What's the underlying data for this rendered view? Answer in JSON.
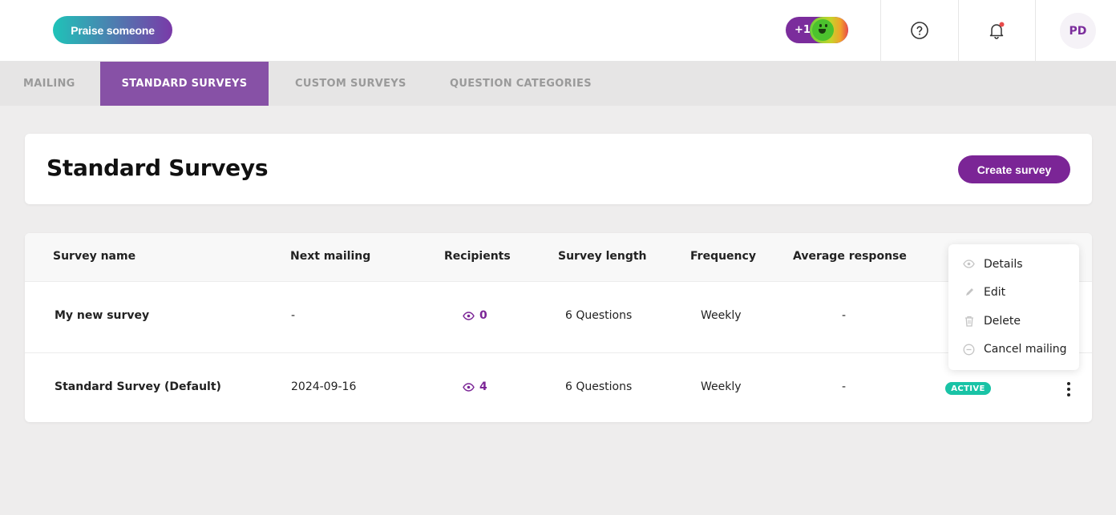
{
  "header": {
    "praise_label": "Praise someone",
    "karma_label": "+1",
    "avatar_initials": "PD"
  },
  "tabs": [
    {
      "label": "MAILING",
      "active": false
    },
    {
      "label": "STANDARD SURVEYS",
      "active": true
    },
    {
      "label": "CUSTOM SURVEYS",
      "active": false
    },
    {
      "label": "QUESTION CATEGORIES",
      "active": false
    }
  ],
  "page": {
    "title": "Standard Surveys",
    "create_label": "Create survey"
  },
  "table": {
    "columns": [
      "Survey name",
      "Next mailing",
      "Recipients",
      "Survey length",
      "Frequency",
      "Average response"
    ],
    "rows": [
      {
        "name": "My new survey",
        "next_mailing": "-",
        "recipients": "0",
        "length": "6 Questions",
        "frequency": "Weekly",
        "average": "-",
        "status": ""
      },
      {
        "name": "Standard Survey (Default)",
        "next_mailing": "2024-09-16",
        "recipients": "4",
        "length": "6 Questions",
        "frequency": "Weekly",
        "average": "-",
        "status": "ACTIVE"
      }
    ]
  },
  "menu": {
    "items": [
      {
        "label": "Details",
        "icon": "eye-icon"
      },
      {
        "label": "Edit",
        "icon": "pencil-icon"
      },
      {
        "label": "Delete",
        "icon": "trash-icon"
      },
      {
        "label": "Cancel mailing",
        "icon": "minus-circle-icon"
      }
    ]
  },
  "colors": {
    "brand_purple": "#7b2596",
    "tab_active": "#8751a6",
    "status_active": "#19c3a6",
    "notification_dot": "#e84a4a"
  }
}
